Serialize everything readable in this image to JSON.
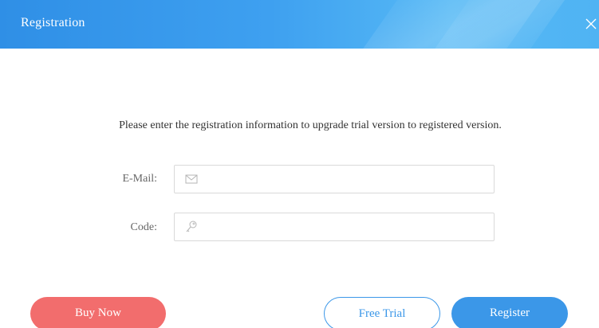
{
  "window": {
    "title": "Registration",
    "close_icon": "close-icon"
  },
  "message": "Please enter the registration information to upgrade trial version to registered version.",
  "form": {
    "email": {
      "label": "E-Mail:",
      "value": "",
      "placeholder": "",
      "icon": "envelope-icon"
    },
    "code": {
      "label": "Code:",
      "value": "",
      "placeholder": "",
      "icon": "key-icon"
    }
  },
  "buttons": {
    "buy_now": "Buy Now",
    "free_trial": "Free Trial",
    "register": "Register"
  },
  "colors": {
    "header_blue": "#3ea0f0",
    "primary_blue": "#3b97e8",
    "buy_red": "#f26d6d"
  }
}
